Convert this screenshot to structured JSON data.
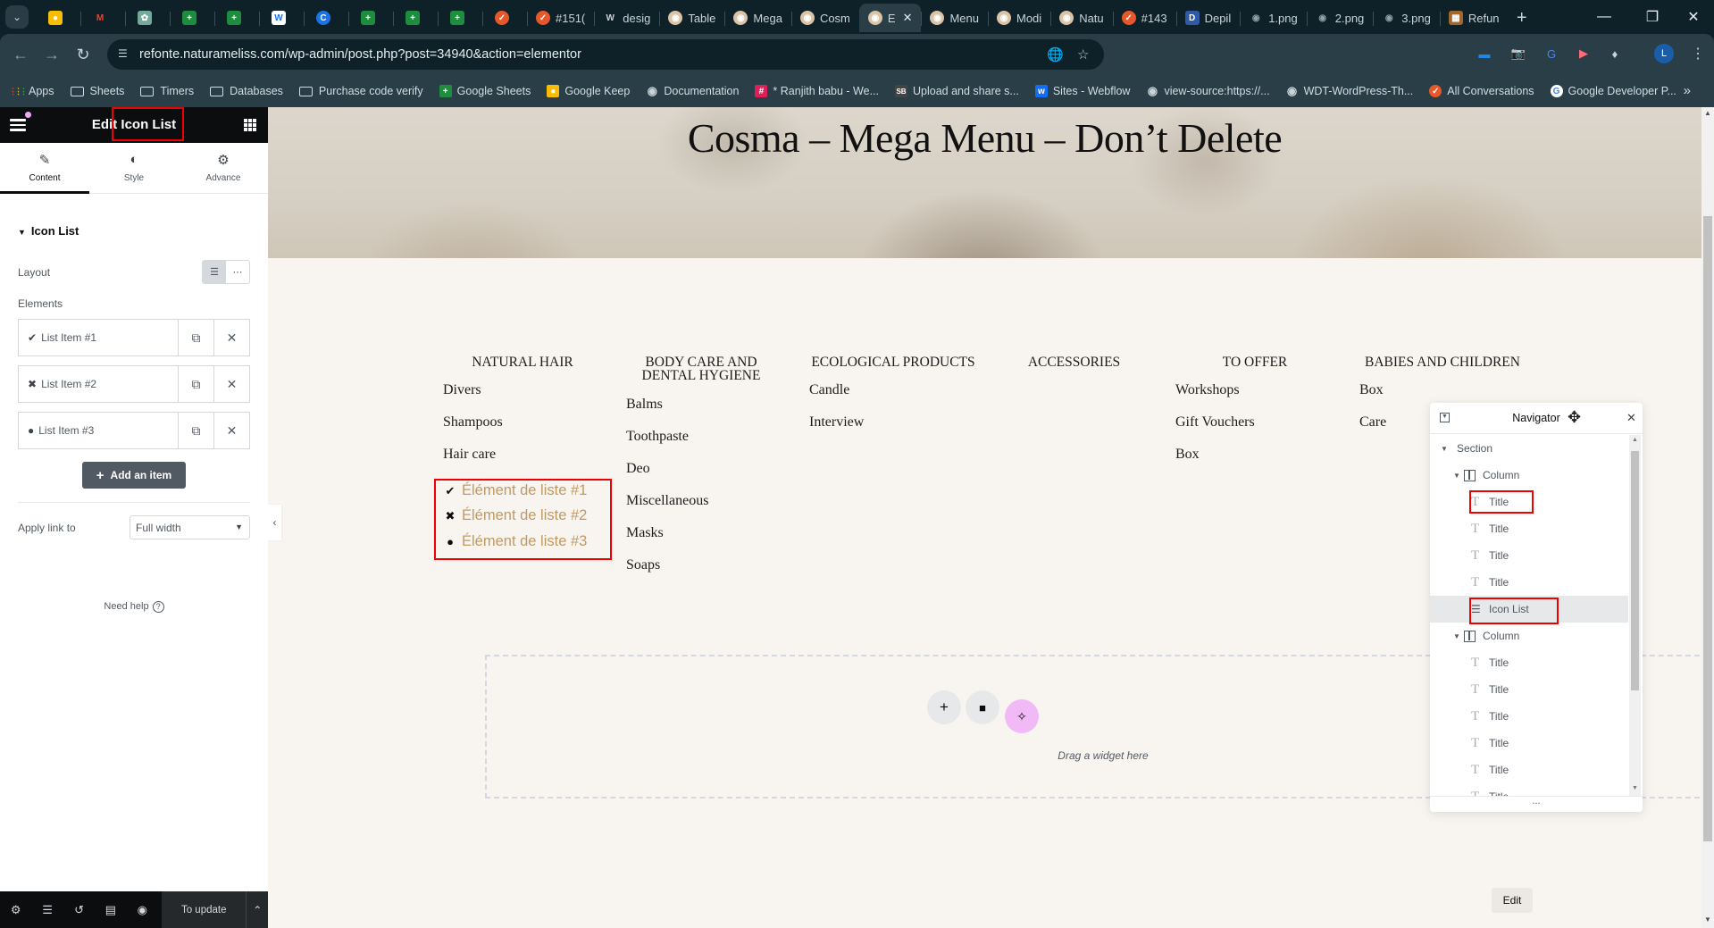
{
  "browser": {
    "tabs": [
      {
        "label": "",
        "icon": "google-keep-icon",
        "color": "#fbbc04"
      },
      {
        "label": "",
        "icon": "gmail-icon",
        "color": "#ea4335"
      },
      {
        "label": "",
        "icon": "chatgpt-icon",
        "color": "#74aa9c"
      },
      {
        "label": "",
        "icon": "google-sheets-icon",
        "color": "#1e8e3e"
      },
      {
        "label": "",
        "icon": "google-sheets-icon",
        "color": "#1e8e3e"
      },
      {
        "label": "",
        "icon": "webflow-icon",
        "color": "#ffffff"
      },
      {
        "label": "",
        "icon": "app-icon",
        "color": "#1a73e8"
      },
      {
        "label": "",
        "icon": "google-sheets-icon",
        "color": "#1e8e3e"
      },
      {
        "label": "",
        "icon": "google-sheets-icon",
        "color": "#1e8e3e"
      },
      {
        "label": "",
        "icon": "google-sheets-icon",
        "color": "#1e8e3e"
      },
      {
        "label": "",
        "icon": "todoist-icon",
        "color": "#e8572a"
      },
      {
        "label": "#151(",
        "icon": "todoist-icon",
        "color": "#e8572a"
      },
      {
        "label": "desig",
        "icon": "wordpress-icon",
        "color": "#c9d3d8"
      },
      {
        "label": "Table",
        "icon": "site-icon",
        "color": "#d9c4a8"
      },
      {
        "label": "Mega",
        "icon": "site-icon",
        "color": "#d9c4a8"
      },
      {
        "label": "Cosm",
        "icon": "site-icon",
        "color": "#d9c4a8"
      },
      {
        "label": "E",
        "icon": "site-icon",
        "color": "#d9c4a8",
        "active": true
      },
      {
        "label": "Menu",
        "icon": "site-icon",
        "color": "#d9c4a8"
      },
      {
        "label": "Modi",
        "icon": "site-icon",
        "color": "#d9c4a8"
      },
      {
        "label": "Natu",
        "icon": "site-icon",
        "color": "#d9c4a8"
      },
      {
        "label": "#143",
        "icon": "todoist-icon",
        "color": "#e8572a"
      },
      {
        "label": "Depil",
        "icon": "depil-icon",
        "color": "#2f5aa8"
      },
      {
        "label": "1.png",
        "icon": "globe-icon",
        "color": "#8fa1a9"
      },
      {
        "label": "2.png",
        "icon": "globe-icon",
        "color": "#8fa1a9"
      },
      {
        "label": "3.png",
        "icon": "globe-icon",
        "color": "#8fa1a9"
      },
      {
        "label": "Refun",
        "icon": "image-icon",
        "color": "#a0662a"
      }
    ],
    "new_tab": "+",
    "url": "refonte.naturameliss.com/wp-admin/post.php?post=34940&action=elementor",
    "profile_initial": "L",
    "bookmarks": [
      {
        "label": "Apps",
        "icon": "apps-icon"
      },
      {
        "label": "Sheets",
        "icon": "folder-icon"
      },
      {
        "label": "Timers",
        "icon": "folder-icon"
      },
      {
        "label": "Databases",
        "icon": "folder-icon"
      },
      {
        "label": "Purchase code verify",
        "icon": "folder-icon"
      },
      {
        "label": "Google Sheets",
        "icon": "google-sheets-icon"
      },
      {
        "label": "Google Keep",
        "icon": "google-keep-icon"
      },
      {
        "label": "Documentation",
        "icon": "globe-icon"
      },
      {
        "label": "* Ranjith babu - We...",
        "icon": "slack-icon"
      },
      {
        "label": "Upload and share s...",
        "icon": "sb-icon"
      },
      {
        "label": "Sites - Webflow",
        "icon": "webflow-icon"
      },
      {
        "label": "view-source:https://...",
        "icon": "globe-icon"
      },
      {
        "label": "WDT-WordPress-Th...",
        "icon": "github-icon"
      },
      {
        "label": "All Conversations",
        "icon": "todoist-icon"
      },
      {
        "label": "Google Developer P...",
        "icon": "google-icon"
      }
    ],
    "bookmarks_more": "»"
  },
  "panel": {
    "title": "Edit Icon List",
    "tabs": [
      {
        "label": "Content",
        "icon": "pencil-icon",
        "active": true
      },
      {
        "label": "Style",
        "icon": "contrast-icon"
      },
      {
        "label": "Advance",
        "icon": "gear-icon"
      }
    ],
    "section_title": "Icon List",
    "layout_label": "Layout",
    "elements_label": "Elements",
    "items": [
      {
        "label": "List Item #1",
        "icon": "✔"
      },
      {
        "label": "List Item #2",
        "icon": "✖"
      },
      {
        "label": "List Item #3",
        "icon": "●"
      }
    ],
    "add_item": "Add an item",
    "apply_link_label": "Apply link to",
    "apply_link_value": "Full width",
    "need_help": "Need help",
    "footer": {
      "publish": "To update"
    }
  },
  "canvas": {
    "hero_title": "Cosma – Mega Menu – Don’t Delete",
    "columns": [
      {
        "heading": "NATURAL HAIR",
        "items": [
          "Divers",
          "Shampoos",
          "Hair care"
        ]
      },
      {
        "heading": "BODY CARE AND DENTAL HYGIENE",
        "items": [
          "Balms",
          "Toothpaste",
          "Deo",
          "Miscellaneous",
          "Masks",
          "Soaps"
        ]
      },
      {
        "heading": "ECOLOGICAL PRODUCTS",
        "items": [
          "Candle",
          "Interview"
        ]
      },
      {
        "heading": "ACCESSORIES",
        "items": []
      },
      {
        "heading": "TO OFFER",
        "items": [
          "Workshops",
          "Gift Vouchers",
          "Box"
        ]
      },
      {
        "heading": "BABIES AND CHILDREN",
        "items": [
          "Box",
          "Care"
        ]
      }
    ],
    "icon_list": [
      {
        "label": "Élément de liste #1",
        "icon": "✔"
      },
      {
        "label": "Élément de liste #2",
        "icon": "✖"
      },
      {
        "label": "Élément de liste #3",
        "icon": "●"
      }
    ],
    "icon_list_color": "#c19a63",
    "dropzone_text": "Drag a widget here",
    "edit_button": "Edit"
  },
  "navigator": {
    "title": "Navigator",
    "tree": [
      {
        "label": "Section",
        "type": "section"
      },
      {
        "label": "Column",
        "type": "column"
      },
      {
        "label": "Title",
        "type": "widget",
        "highlight": true
      },
      {
        "label": "Title",
        "type": "widget"
      },
      {
        "label": "Title",
        "type": "widget"
      },
      {
        "label": "Title",
        "type": "widget"
      },
      {
        "label": "Icon List",
        "type": "widget",
        "selected": true,
        "highlight": true
      },
      {
        "label": "Column",
        "type": "column"
      },
      {
        "label": "Title",
        "type": "widget"
      },
      {
        "label": "Title",
        "type": "widget"
      },
      {
        "label": "Title",
        "type": "widget"
      },
      {
        "label": "Title",
        "type": "widget"
      },
      {
        "label": "Title",
        "type": "widget"
      },
      {
        "label": "Title",
        "type": "widget"
      }
    ],
    "footer": "..."
  }
}
